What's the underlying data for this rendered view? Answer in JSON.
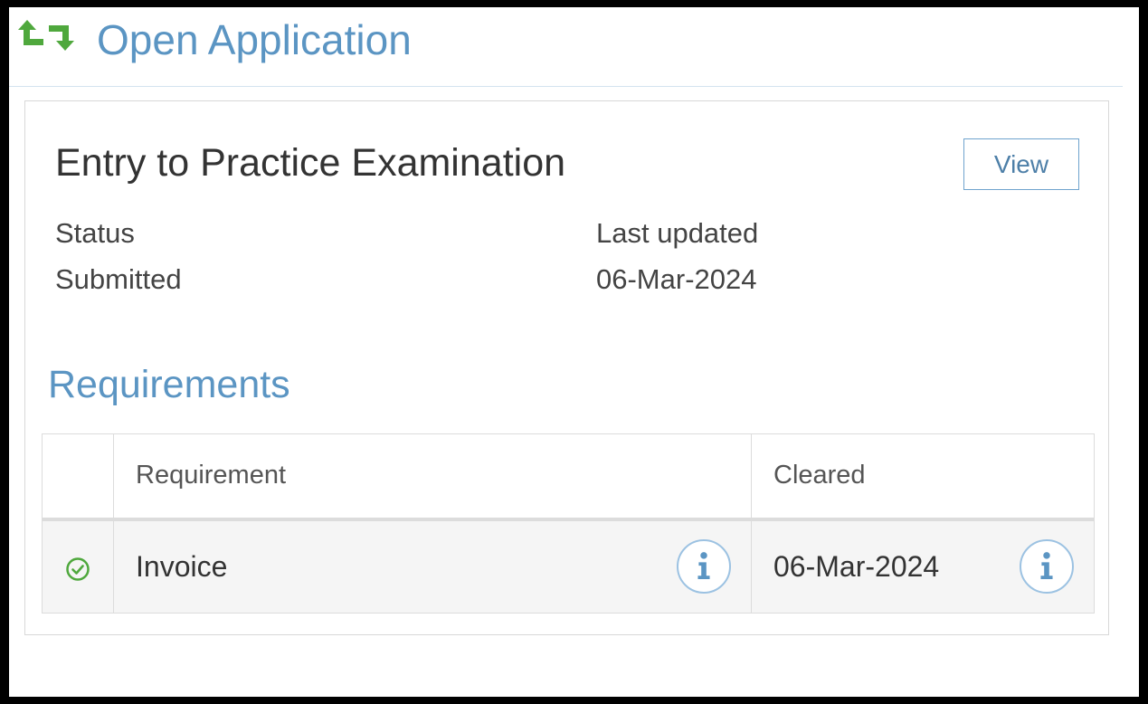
{
  "header": {
    "title": "Open Application",
    "icon": "repeat-arrows-icon",
    "icon_color": "#4fa83d",
    "title_color": "#5b95c3"
  },
  "application": {
    "title": "Entry to Practice Examination",
    "view_label": "View",
    "status_label": "Status",
    "status_value": "Submitted",
    "updated_label": "Last updated",
    "updated_value": "06-Mar-2024"
  },
  "requirements": {
    "title": "Requirements",
    "columns": [
      "",
      "Requirement",
      "Cleared"
    ],
    "rows": [
      {
        "status_icon": "check-circle-icon",
        "status_color": "#4fa83d",
        "requirement": "Invoice",
        "cleared": "06-Mar-2024"
      }
    ]
  }
}
